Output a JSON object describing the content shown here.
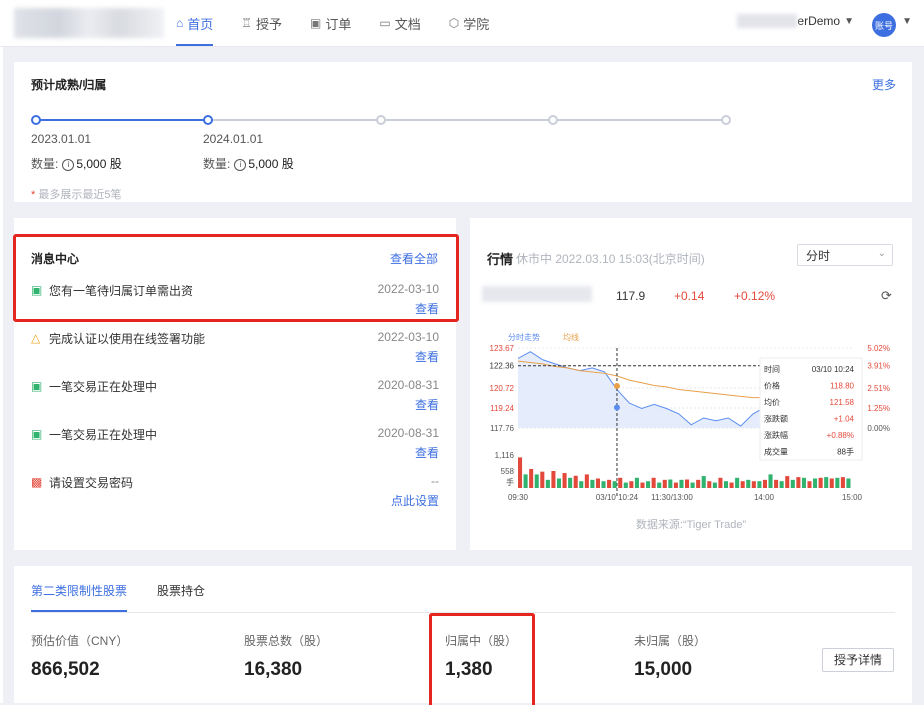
{
  "nav": {
    "items": [
      {
        "label": "首页",
        "icon": "home-icon",
        "glyph": "⌂",
        "active": true
      },
      {
        "label": "授予",
        "icon": "grant-icon",
        "glyph": "♖",
        "active": false
      },
      {
        "label": "订单",
        "icon": "order-icon",
        "glyph": "▣",
        "active": false
      },
      {
        "label": "文档",
        "icon": "folder-icon",
        "glyph": "▭",
        "active": false
      },
      {
        "label": "学院",
        "icon": "academy-icon",
        "glyph": "⬡",
        "active": false
      }
    ],
    "user_name": "erDemo",
    "avatar_label": "账号"
  },
  "vesting": {
    "title": "预计成熟/归属",
    "more": "更多",
    "entries": [
      {
        "date": "2023.01.01",
        "qty_label": "数量:",
        "qty": "5,000 股"
      },
      {
        "date": "2024.01.01",
        "qty_label": "数量:",
        "qty": "5,000 股"
      }
    ],
    "note_star": "*",
    "note": "最多展示最近5笔"
  },
  "messages": {
    "title": "消息中心",
    "view_all": "查看全部",
    "items": [
      {
        "icon": "calendar-icon",
        "text": "您有一笔待归属订单需出资",
        "date": "2022-03-10",
        "action": "查看",
        "color": "#2fb36f"
      },
      {
        "icon": "bell-icon",
        "text": "完成认证以使用在线签署功能",
        "date": "2022-03-10",
        "action": "查看",
        "color": "#f1a524"
      },
      {
        "icon": "calendar-icon",
        "text": "一笔交易正在处理中",
        "date": "2020-08-31",
        "action": "查看",
        "color": "#2fb36f"
      },
      {
        "icon": "calendar-icon",
        "text": "一笔交易正在处理中",
        "date": "2020-08-31",
        "action": "查看",
        "color": "#2fb36f"
      },
      {
        "icon": "lock-icon",
        "text": "请设置交易密码",
        "date": "--",
        "action": "点此设置",
        "color": "#e3493b"
      }
    ]
  },
  "market": {
    "title": "行情",
    "status": "休市中  2022.03.10 15:03(北京时间)",
    "mode": "分时",
    "price": "117.9",
    "change": "+0.14",
    "change_pct": "+0.12%",
    "source": "数据来源:“Tiger Trade”",
    "colors": {
      "up": "#e3493b",
      "down": "#2fb36f",
      "price_line": "#5b8def",
      "avg_line": "#e8a04a"
    }
  },
  "chart_data": {
    "type": "line",
    "legend": [
      "分时走势",
      "均线"
    ],
    "y_ticks_left": [
      "123.67",
      "122.36",
      "120.72",
      "119.24",
      "117.76"
    ],
    "y_ticks_right": [
      "5.02%",
      "3.91%",
      "2.51%",
      "1.25%",
      "0.00%"
    ],
    "volume_ticks": [
      "1,116",
      "558",
      "手"
    ],
    "x_ticks": [
      "09:30",
      "03/10 10:24",
      "11:30/13:00",
      "14:00",
      "15:00"
    ],
    "ylim": [
      117.76,
      123.67
    ],
    "price": [
      122.9,
      123.4,
      122.8,
      122.5,
      122.2,
      122.0,
      122.2,
      121.9,
      120.6,
      119.6,
      119.2,
      119.5,
      119.2,
      118.8,
      118.0,
      118.5,
      118.3,
      118.5,
      117.9,
      118.8,
      119.3,
      118.9,
      118.0,
      118.2,
      117.8,
      118.3,
      117.9,
      117.9
    ],
    "avg": [
      122.7,
      122.6,
      122.5,
      122.3,
      122.2,
      122.0,
      121.9,
      121.8,
      121.6,
      121.3,
      121.1,
      120.9,
      120.8,
      120.6,
      120.5,
      120.4,
      120.3,
      120.2,
      120.1,
      120.0,
      120.0,
      119.9,
      119.8,
      119.8,
      119.7,
      119.7,
      119.6,
      119.6
    ],
    "tooltip": [
      {
        "label": "时间",
        "value": "03/10 10:24",
        "tone": "normal"
      },
      {
        "label": "价格",
        "value": "118.80",
        "tone": "up"
      },
      {
        "label": "均价",
        "value": "121.58",
        "tone": "up"
      },
      {
        "label": "涨跌额",
        "value": "+1.04",
        "tone": "up"
      },
      {
        "label": "涨跌幅",
        "value": "+0.88%",
        "tone": "up"
      },
      {
        "label": "成交量",
        "value": "88手",
        "tone": "normal"
      }
    ]
  },
  "holdings": {
    "tabs": [
      "第二类限制性股票",
      "股票持仓"
    ],
    "stats": [
      {
        "label": "预估价值（CNY）",
        "value": "866,502"
      },
      {
        "label": "股票总数（股）",
        "value": "16,380"
      },
      {
        "label": "归属中（股）",
        "value": "1,380"
      },
      {
        "label": "未归属（股）",
        "value": "15,000"
      }
    ],
    "grant_button": "授予详情"
  }
}
